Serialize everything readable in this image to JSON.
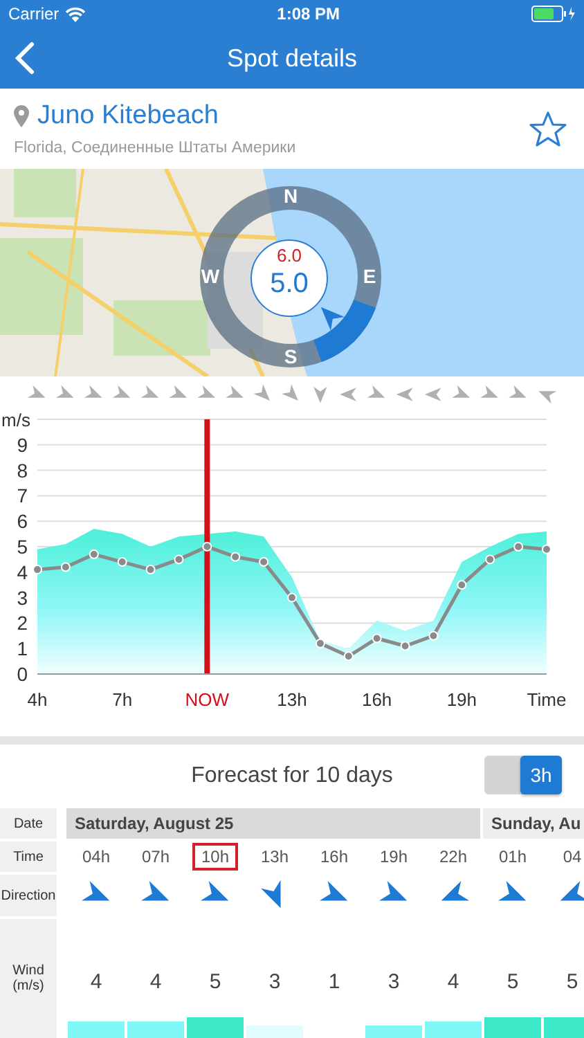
{
  "status_bar": {
    "carrier": "Carrier",
    "time": "1:08 PM"
  },
  "nav_bar": {
    "title": "Spot details"
  },
  "spot": {
    "name": "Juno Kitebeach",
    "region": "Florida, Соединенные Штаты Америки",
    "favorite": false
  },
  "map": {
    "kind": "picture",
    "compass": {
      "north": "N",
      "east": "E",
      "south": "S",
      "west": "W",
      "gust": "6.0",
      "speed": "5.0"
    }
  },
  "chart": {
    "chart_data": {
      "type": "area",
      "xlabel": "Time",
      "ylabel": "m/s",
      "x": [
        4,
        5,
        6,
        7,
        8,
        9,
        10,
        11,
        12,
        13,
        14,
        15,
        16,
        17,
        18,
        19,
        20,
        21,
        22
      ],
      "series": [
        {
          "color": "#4cf0d8",
          "values": [
            4.9,
            5.1,
            5.7,
            5.5,
            5.0,
            5.4,
            null,
            5.6,
            5.4,
            3.8,
            1.3,
            1.0,
            2.1,
            1.7,
            2.1,
            4.4,
            5.0,
            5.5,
            5.6
          ]
        },
        {
          "type": "line",
          "marker": "circle",
          "color": "#8a8a8a",
          "values": [
            4.1,
            4.2,
            4.7,
            4.4,
            4.1,
            4.5,
            5.0,
            4.6,
            4.4,
            3.0,
            1.2,
            0.7,
            1.4,
            1.1,
            1.5,
            3.5,
            4.5,
            5.0,
            4.9
          ]
        }
      ],
      "grid": true,
      "xlim": [
        4,
        22
      ],
      "ylim": [
        0,
        10
      ],
      "yticks": [
        0,
        1,
        2,
        3,
        4,
        5,
        6,
        7,
        8,
        9
      ],
      "xticks": [
        {
          "value": 4,
          "label": "4h"
        },
        {
          "value": 7,
          "label": "7h"
        },
        {
          "value": 10,
          "label": "NOW"
        },
        {
          "value": 13,
          "label": "13h"
        },
        {
          "value": 16,
          "label": "16h"
        },
        {
          "value": 19,
          "label": "19h"
        }
      ],
      "ref_lines": [
        {
          "axis": "x",
          "value": 10
        }
      ]
    }
  },
  "forecast": {
    "title": "Forecast for 10 days",
    "interval_switch": {
      "label": "3h",
      "on": true
    },
    "row_labels": {
      "date": "Date",
      "time": "Time",
      "direction": "Direction",
      "wind": "Wind\n(m/s)"
    },
    "days": [
      {
        "label": "Saturday, August 25",
        "selected": true
      },
      {
        "label": "Sunday, Au",
        "selected": false
      }
    ],
    "slots": [
      {
        "time": "04h",
        "selected": false,
        "wind": "4",
        "color": "#80f8f8"
      },
      {
        "time": "07h",
        "selected": false,
        "wind": "4",
        "color": "#80f8f8"
      },
      {
        "time": "10h",
        "selected": true,
        "wind": "5",
        "color": "#3de8c8"
      },
      {
        "time": "13h",
        "selected": false,
        "wind": "3",
        "color": "#e0fcfc"
      },
      {
        "time": "16h",
        "selected": false,
        "wind": "1"
      },
      {
        "time": "19h",
        "selected": false,
        "wind": "3",
        "color": "#80f8f8"
      },
      {
        "time": "22h",
        "selected": false,
        "wind": "4",
        "color": "#80f8f8"
      },
      {
        "time": "01h",
        "selected": false,
        "wind": "5",
        "color": "#3de8c8"
      },
      {
        "time": "04",
        "selected": false,
        "wind": "5",
        "color": "#3de8c8"
      }
    ]
  }
}
